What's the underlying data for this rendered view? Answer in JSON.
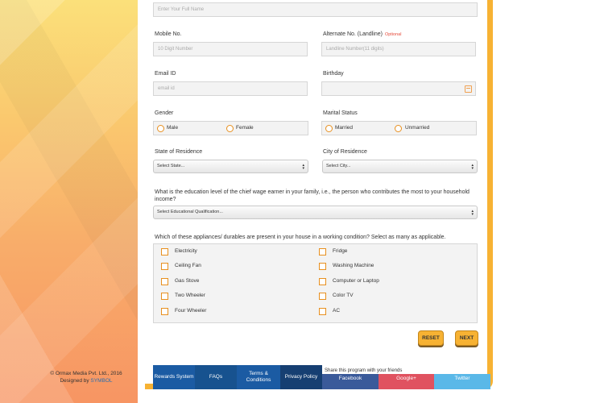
{
  "footer": {
    "copyright": "© Ormax Media Pvt. Ltd., 2016",
    "designed_by": "Designed by",
    "designer": "SYMBOL"
  },
  "form": {
    "full_name_placeholder": "Enter Your Full Name",
    "mobile": {
      "label": "Mobile No.",
      "placeholder": "10 Digit Number"
    },
    "alternate": {
      "label": "Alternate No. (Landline)",
      "optional": "Optional",
      "placeholder": "Landline Number(11 digits)"
    },
    "email": {
      "label": "Email ID",
      "placeholder": "email id"
    },
    "birthday": {
      "label": "Birthday"
    },
    "gender": {
      "label": "Gender",
      "options": [
        "Male",
        "Female"
      ]
    },
    "marital": {
      "label": "Marital Status",
      "options": [
        "Married",
        "Unmarried"
      ]
    },
    "state": {
      "label": "State of Residence",
      "selected": "Select State..."
    },
    "city": {
      "label": "City of Residence",
      "selected": "Select City..."
    },
    "education": {
      "question": "What is the education level of the chief wage earner in your family, i.e., the person who contributes the most to your household income?",
      "selected": "Select Educational Qualification..."
    },
    "appliances": {
      "question": "Which of these appliances/ durables are present in your house in a working condition? Select as many as applicable.",
      "left": [
        "Electricity",
        "Ceiling Fan",
        "Gas Stove",
        "Two Wheeler",
        "Four Wheeler"
      ],
      "right": [
        "Fridge",
        "Washing Machine",
        "Computer or Laptop",
        "Color TV",
        "AC"
      ]
    },
    "reset_label": "RESET",
    "next_label": "NEXT"
  },
  "nav": {
    "items": [
      "Rewards System",
      "FAQs",
      "Terms & Conditions",
      "Privacy Policy"
    ],
    "colors": [
      "#1b5ba3",
      "#17528f",
      "#1b5ba3",
      "#163f72"
    ],
    "share_text": "Share this program with your friends",
    "social": [
      "Facebook",
      "Google+",
      "Twitter"
    ],
    "social_colors": [
      "#3a5a9a",
      "#e05260",
      "#5ab8e8"
    ]
  }
}
